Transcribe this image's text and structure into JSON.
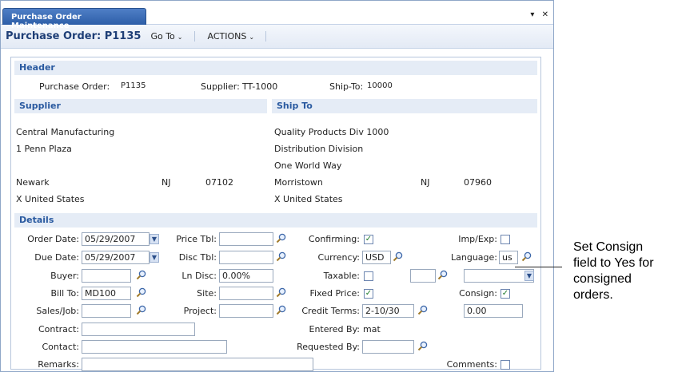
{
  "tab": {
    "label": "Purchase Order Maintenance",
    "menu_glyph": "▾",
    "close_glyph": "✕"
  },
  "toolbar": {
    "title": "Purchase Order: P1135",
    "goto": "Go To",
    "actions": "ACTIONS"
  },
  "header": {
    "section": "Header",
    "po_label": "Purchase Order:",
    "po_value": "P1135",
    "supplier_label": "Supplier:",
    "supplier_value": "TT-1000",
    "shipto_label": "Ship-To:",
    "shipto_value": "10000"
  },
  "supplier": {
    "section": "Supplier",
    "name": "Central Manufacturing",
    "addr1": "1 Penn Plaza",
    "city": "Newark",
    "state": "NJ",
    "zip": "07102",
    "country": "X United States"
  },
  "shipto": {
    "section": "Ship To",
    "name": "Quality Products Div 1000",
    "addr1": "Distribution Division",
    "addr2": "One World Way",
    "city": "Morristown",
    "state": "NJ",
    "zip": "07960",
    "country": "X United States"
  },
  "details": {
    "section": "Details",
    "order_date_label": "Order Date:",
    "order_date": "05/29/2007",
    "due_date_label": "Due Date:",
    "due_date": "05/29/2007",
    "buyer_label": "Buyer:",
    "buyer": "",
    "bill_to_label": "Bill To:",
    "bill_to": "MD100",
    "sales_job_label": "Sales/Job:",
    "sales_job": "",
    "contract_label": "Contract:",
    "contract": "",
    "contact_label": "Contact:",
    "contact": "",
    "remarks_label": "Remarks:",
    "remarks": "",
    "price_tbl_label": "Price Tbl:",
    "price_tbl": "",
    "disc_tbl_label": "Disc Tbl:",
    "disc_tbl": "",
    "ln_disc_label": "Ln Disc:",
    "ln_disc": "0.00%",
    "site_label": "Site:",
    "site": "",
    "project_label": "Project:",
    "project": "",
    "confirming_label": "Confirming:",
    "confirming": true,
    "currency_label": "Currency:",
    "currency": "USD",
    "taxable_label": "Taxable:",
    "taxable": false,
    "fixed_price_label": "Fixed Price:",
    "fixed_price": true,
    "credit_terms_label": "Credit Terms:",
    "credit_terms": "2-10/30",
    "credit_amount": "0.00",
    "entered_by_label": "Entered By:",
    "entered_by": "mat",
    "requested_by_label": "Requested By:",
    "requested_by": "",
    "imp_exp_label": "Imp/Exp:",
    "imp_exp": false,
    "language_label": "Language:",
    "language": "us",
    "consign_label": "Consign:",
    "consign": true,
    "comments_label": "Comments:",
    "comments": false
  },
  "callout": {
    "text": "Set Consign\nfield to Yes for\nconsigned\norders."
  },
  "colors": {
    "tab": "#2d5ea8",
    "section_bg": "#e5ecf6",
    "section_text": "#2a5aa0",
    "title": "#1f3f77"
  }
}
